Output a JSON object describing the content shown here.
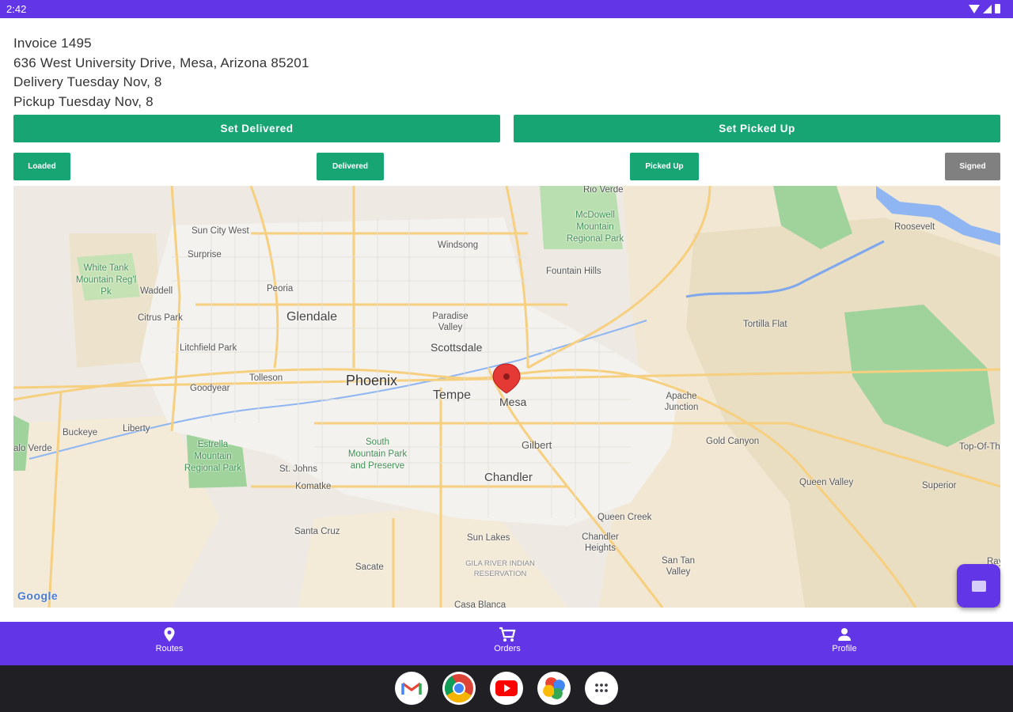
{
  "status_bar": {
    "time": "2:42"
  },
  "invoice": {
    "number": "Invoice 1495",
    "address": "636 West University Drive, Mesa, Arizona 85201",
    "delivery": "Delivery Tuesday Nov, 8",
    "pickup": "Pickup Tuesday Nov, 8"
  },
  "actions": {
    "set_delivered": "Set Delivered",
    "set_picked_up": "Set Picked Up"
  },
  "status_steps": [
    {
      "label": "Loaded",
      "color": "#17a673"
    },
    {
      "label": "Delivered",
      "color": "#17a673"
    },
    {
      "label": "Picked Up",
      "color": "#17a673"
    },
    {
      "label": "Signed",
      "color": "#808080"
    }
  ],
  "map": {
    "attribution": "Google",
    "labels": {
      "rio_verde": "Rio Verde",
      "sun_city_west": "Sun City West",
      "surprise": "Surprise",
      "white_tank": "White Tank Mountain Reg'l Pk",
      "waddell": "Waddell",
      "peoria": "Peoria",
      "glendale": "Glendale",
      "citrus_park": "Citrus Park",
      "litchfield_park": "Litchfield Park",
      "tolleson": "Tolleson",
      "goodyear": "Goodyear",
      "phoenix": "Phoenix",
      "tempe": "Tempe",
      "mesa": "Mesa",
      "scottsdale": "Scottsdale",
      "paradise_valley": "Paradise Valley",
      "windsong": "Windsong",
      "fountain_hills": "Fountain Hills",
      "mcdowell": "McDowell Mountain Regional Park",
      "roosevelt": "Roosevelt",
      "tortilla_flat": "Tortilla Flat",
      "apache_junction": "Apache Junction",
      "gilbert": "Gilbert",
      "chandler": "Chandler",
      "gold_canyon": "Gold Canyon",
      "queen_valley": "Queen Valley",
      "top_of_the": "Top-Of-Th",
      "superior": "Superior",
      "buckeye": "Buckeye",
      "liberty": "Liberty",
      "palo_verde": "alo Verde",
      "estrella": "Estrella Mountain Regional Park",
      "st_johns": "St. Johns",
      "komatke": "Komatke",
      "south_mountain": "South Mountain Park and Preserve",
      "santa_cruz": "Santa Cruz",
      "sacate": "Sacate",
      "sun_lakes": "Sun Lakes",
      "gila_river": "GILA RIVER INDIAN RESERVATION",
      "queen_creek": "Queen Creek",
      "chandler_heights": "Chandler Heights",
      "san_tan_valley": "San Tan Valley",
      "casa_blanca": "Casa Blanca",
      "ray": "Ray"
    }
  },
  "bottom_nav": [
    {
      "label": "Routes",
      "icon": "location-pin-icon"
    },
    {
      "label": "Orders",
      "icon": "cart-icon"
    },
    {
      "label": "Profile",
      "icon": "person-icon"
    }
  ],
  "dock_apps": [
    "gmail-icon",
    "chrome-icon",
    "youtube-icon",
    "photos-icon",
    "app-drawer-icon"
  ]
}
